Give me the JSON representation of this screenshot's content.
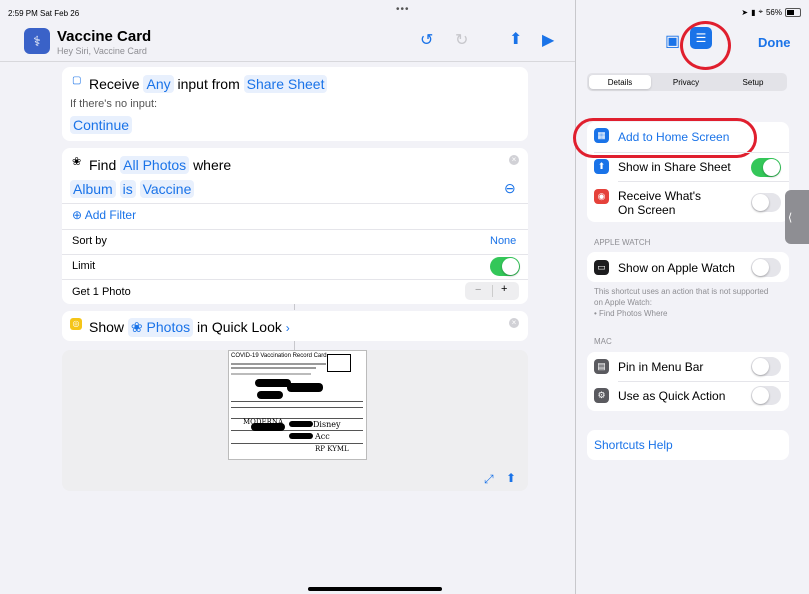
{
  "status": {
    "time": "2:59 PM  Sat Feb 26",
    "battery": "56%"
  },
  "header": {
    "title": "Vaccine Card",
    "subtitle": "Hey Siri, Vaccine Card",
    "done_label": "Done"
  },
  "receive": {
    "word_receive": "Receive",
    "any": "Any",
    "input_from": "input from",
    "source": "Share Sheet",
    "no_input": "If there's no input:",
    "continue": "Continue"
  },
  "find": {
    "word_find": "Find",
    "target": "All Photos",
    "where": "where",
    "field": "Album",
    "op": "is",
    "value": "Vaccine",
    "add_filter": "Add Filter",
    "sort_by": "Sort by",
    "sort_value": "None",
    "limit": "Limit",
    "get": "Get 1 Photo",
    "stepper_minus": "−",
    "stepper_plus": "+"
  },
  "show": {
    "word_show": "Show",
    "target": "Photos",
    "in_quick_look": "in Quick Look"
  },
  "document": {
    "title": "COVID-19 Vaccination Record Card",
    "handwriting": [
      "MODERNA",
      "Disney",
      "Acc",
      "RP KYML"
    ]
  },
  "details": {
    "tabs": [
      "Details",
      "Privacy",
      "Setup"
    ],
    "add_home": "Add to Home Screen",
    "show_share": "Show in Share Sheet",
    "receive_screen": "Receive What's\nOn Screen",
    "apple_watch_header": "APPLE WATCH",
    "show_watch": "Show on Apple Watch",
    "watch_note": "This shortcut uses an action that is not supported on Apple Watch:\n• Find Photos Where",
    "mac_header": "MAC",
    "pin_menu": "Pin in Menu Bar",
    "quick_action": "Use as Quick Action",
    "help": "Shortcuts Help"
  },
  "colors": {
    "accent": "#1a73e8",
    "toggle_on": "#34c759",
    "annotation_red": "#e01f2e"
  }
}
